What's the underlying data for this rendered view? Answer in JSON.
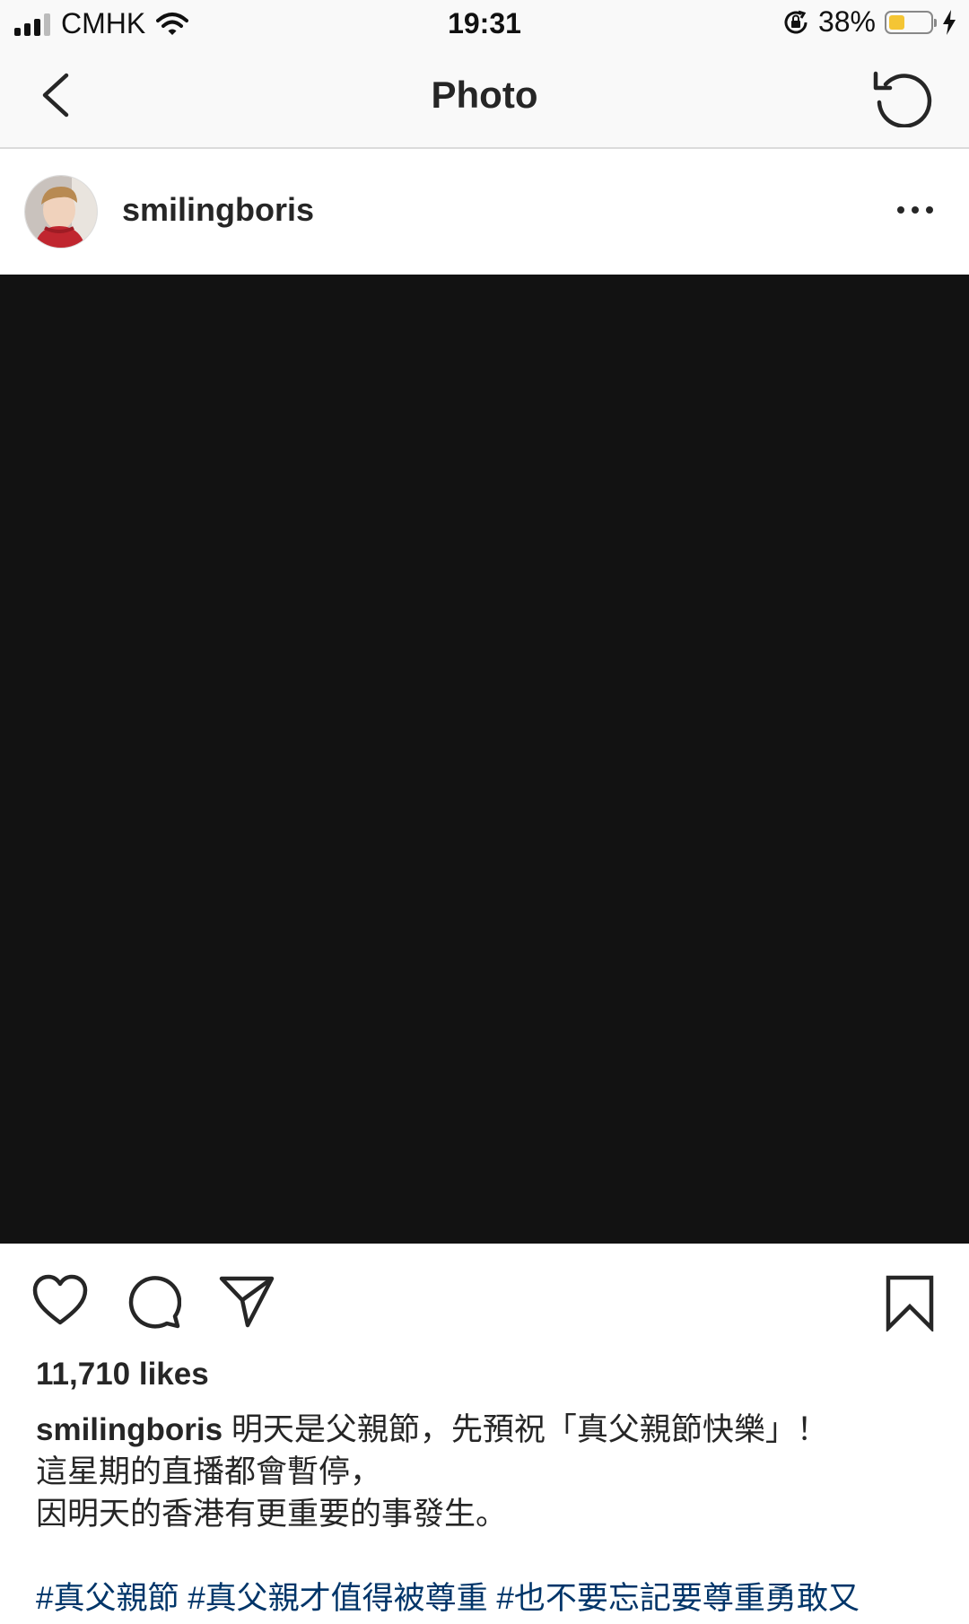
{
  "status_bar": {
    "carrier": "CMHK",
    "time": "19:31",
    "battery_percent": "38%",
    "battery_level": 0.38,
    "battery_color": "#f4c534"
  },
  "nav": {
    "title": "Photo",
    "back_icon": "chevron-left-icon",
    "refresh_icon": "refresh-icon"
  },
  "post": {
    "username": "smilingboris",
    "photo_color": "#121212",
    "likes": "11,710 likes",
    "caption_lines": [
      "明天是父親節，先預祝「真父親節快樂」！",
      "這星期的直播都會暫停，",
      "因明天的香港有更重要的事發生。"
    ],
    "hashtags": "#真父親節 #真父親才值得被尊重 #也不要忘記要尊重勇敢又"
  },
  "actions": {
    "like_icon": "heart-icon",
    "comment_icon": "comment-icon",
    "share_icon": "send-icon",
    "save_icon": "bookmark-icon"
  }
}
